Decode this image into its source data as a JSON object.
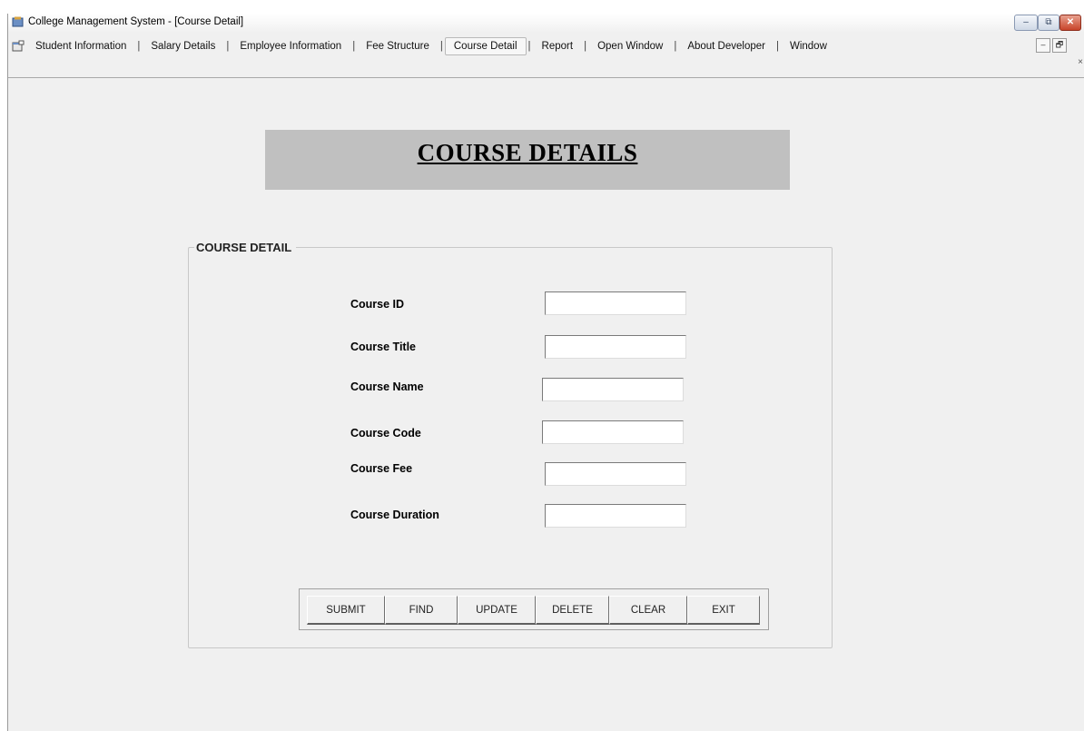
{
  "window": {
    "title": "College Management System - [Course Detail]",
    "controls": {
      "minimize": "–",
      "restore": "⧉",
      "close": "✕"
    }
  },
  "menu": {
    "items": [
      "Student Information",
      "Salary Details",
      "Employee Information",
      "Fee Structure",
      "Course Detail",
      "Report",
      "Open Window",
      "About Developer",
      "Window"
    ],
    "separator": "|",
    "active": "Course Detail",
    "child_controls": {
      "minimize": "–",
      "restore": "🗗",
      "close": "×"
    }
  },
  "header": {
    "title": "COURSE DETAILS"
  },
  "group": {
    "legend": "COURSE DETAIL"
  },
  "form": {
    "course_id": {
      "label": "Course ID",
      "value": ""
    },
    "course_title": {
      "label": "Course Title",
      "value": ""
    },
    "course_name": {
      "label": "Course Name",
      "value": ""
    },
    "course_code": {
      "label": "Course Code",
      "value": ""
    },
    "course_fee": {
      "label": "Course Fee",
      "value": ""
    },
    "course_duration": {
      "label": "Course Duration",
      "value": ""
    }
  },
  "buttons": {
    "submit": "SUBMIT",
    "find": "FIND",
    "update": "UPDATE",
    "delete": "DELETE",
    "clear": "CLEAR",
    "exit": "EXIT"
  },
  "colors": {
    "window_bg": "#f0f0f0",
    "banner_bg": "#c0c0c0",
    "close_button": "#c8442a"
  }
}
